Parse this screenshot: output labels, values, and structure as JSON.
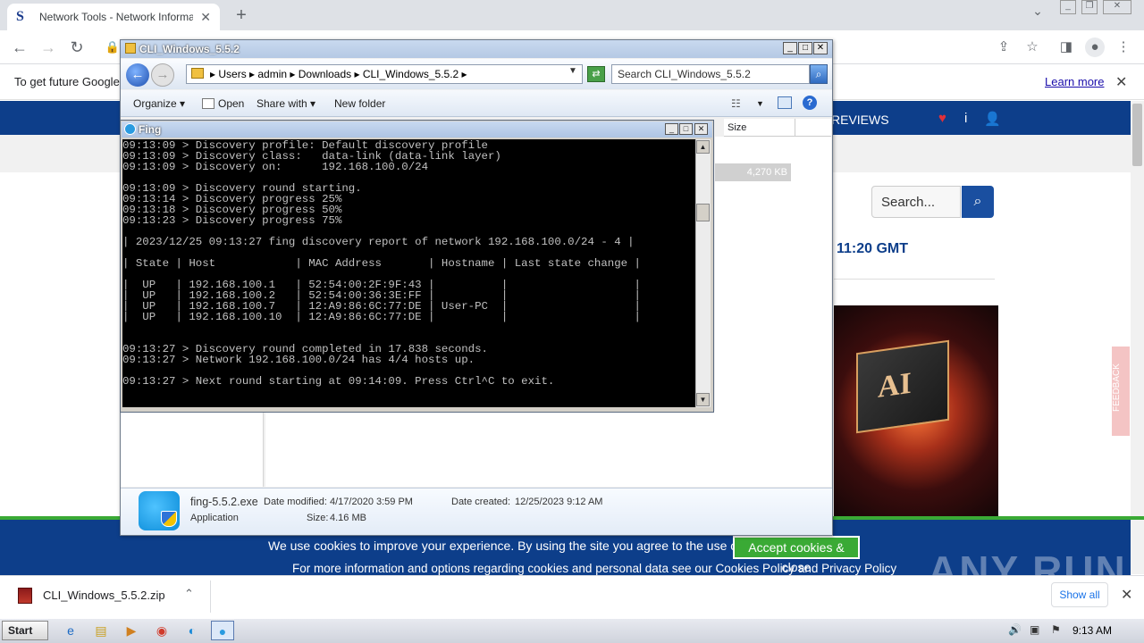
{
  "browser": {
    "tab_title": "Network Tools - Network Information",
    "tab_favicon": "S",
    "new_tab": "+",
    "infobar_text": "To get future Google",
    "learn_more": "Learn more"
  },
  "site": {
    "nav_reviews": "REVIEWS",
    "search_placeholder": "Search...",
    "time_fragment": "11:20 GMT",
    "feedback": "FEEDBACK",
    "ai_label": "AI",
    "cookie_text": "We use cookies to improve your experience. By using the site you agree to the use of cookies.",
    "cookie_button": "Accept cookies & close",
    "cookie_more": "For more information and options regarding cookies and personal data see our Cookies Policy and Privacy Policy",
    "watermark": "ANY RUN"
  },
  "download": {
    "filename": "CLI_Windows_5.5.2.zip",
    "show_all": "Show all"
  },
  "explorer": {
    "title": "CLI_Windows_5.5.2",
    "breadcrumb": "▸ Users ▸ admin ▸ Downloads ▸ CLI_Windows_5.5.2 ▸",
    "search_placeholder": "Search CLI_Windows_5.5.2",
    "organize": "Organize ▾",
    "open": "Open",
    "share_with": "Share with ▾",
    "new_folder": "New folder",
    "col_size": "Size",
    "selected_size": "4,270 KB",
    "detail_name": "fing-5.5.2.exe",
    "detail_type": "Application",
    "detail_modified_label": "Date modified:",
    "detail_modified": "4/17/2020 3:59 PM",
    "detail_size_label": "Size:",
    "detail_size": "4.16 MB",
    "detail_created_label": "Date created:",
    "detail_created": "12/25/2023 9:12 AM"
  },
  "fing": {
    "title": "Fing",
    "console_lines": [
      "09:13:09 > Discovery profile: Default discovery profile",
      "09:13:09 > Discovery class:   data-link (data-link layer)",
      "09:13:09 > Discovery on:      192.168.100.0/24",
      "",
      "09:13:09 > Discovery round starting.",
      "09:13:14 > Discovery progress 25%",
      "09:13:18 > Discovery progress 50%",
      "09:13:23 > Discovery progress 75%",
      "",
      "| 2023/12/25 09:13:27 fing discovery report of network 192.168.100.0/24 - 4 |",
      "",
      "| State | Host            | MAC Address       | Hostname | Last state change |",
      "",
      "|  UP   | 192.168.100.1   | 52:54:00:2F:9F:43 |          |                   |",
      "|  UP   | 192.168.100.2   | 52:54:00:36:3E:FF |          |                   |",
      "|  UP   | 192.168.100.7   | 12:A9:86:6C:77:DE | User-PC  |                   |",
      "|  UP   | 192.168.100.10  | 12:A9:86:6C:77:DE |          |                   |",
      "",
      "",
      "09:13:27 > Discovery round completed in 17.838 seconds.",
      "09:13:27 > Network 192.168.100.0/24 has 4/4 hosts up.",
      "",
      "09:13:27 > Next round starting at 09:14:09. Press Ctrl^C to exit."
    ]
  },
  "taskbar": {
    "start": "Start",
    "clock": "9:13 AM"
  }
}
